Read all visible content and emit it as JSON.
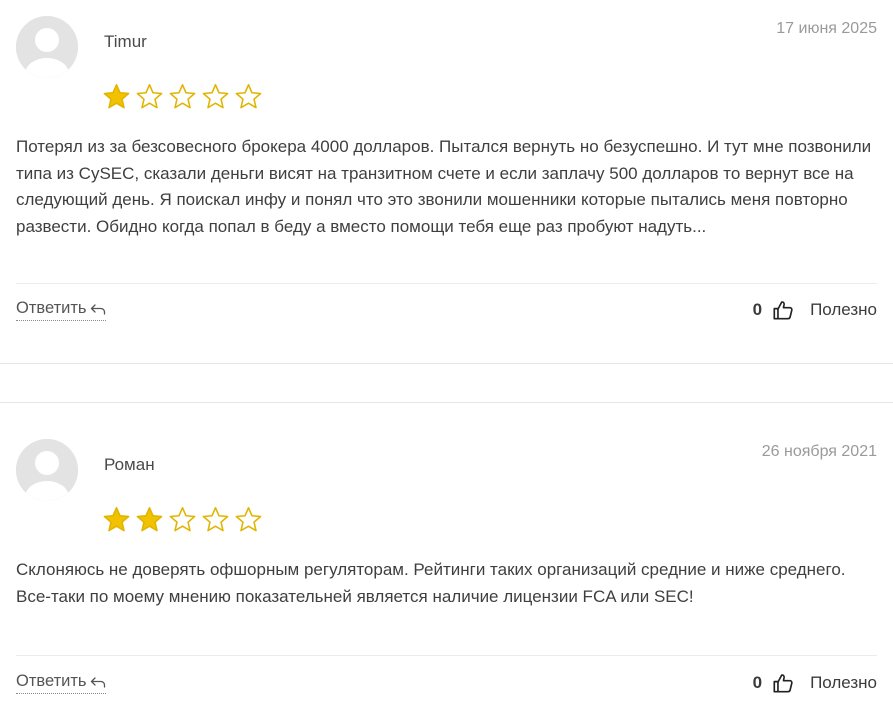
{
  "reviews": [
    {
      "author": "Timur",
      "date": "17 июня 2025",
      "rating": 1,
      "max_rating": 5,
      "text": "Потерял из за безсовесного брокера 4000 долларов. Пытался вернуть но безуспешно. И тут мне позвонили типа из CySEC, сказали деньги висят на транзитном счете и если заплачу 500 долларов то вернут все на следующий день. Я поискал инфу и понял что это звонили мошенники которые пытались меня повторно развести. Обидно когда попал в беду а вместо помощи тебя еще раз пробуют надуть...",
      "reply_label": "Ответить",
      "useful_count": "0",
      "useful_label": "Полезно"
    },
    {
      "author": "Роман",
      "date": "26 ноября 2021",
      "rating": 2,
      "max_rating": 5,
      "text": "Склоняюсь не доверять офшорным регуляторам. Рейтинги таких организаций средние и ниже среднего. Все-таки по моему мнению показательней является наличие лицензии FCA или SEC!",
      "reply_label": "Ответить",
      "useful_count": "0",
      "useful_label": "Полезно"
    }
  ],
  "colors": {
    "star_filled": "#f2c200",
    "star_outline": "#e0b400",
    "date": "#9a9a9a",
    "divider": "#ececec"
  },
  "icons": {
    "avatar": "avatar-placeholder-icon",
    "reply": "reply-arrow-icon",
    "useful": "thumbs-up-icon"
  }
}
